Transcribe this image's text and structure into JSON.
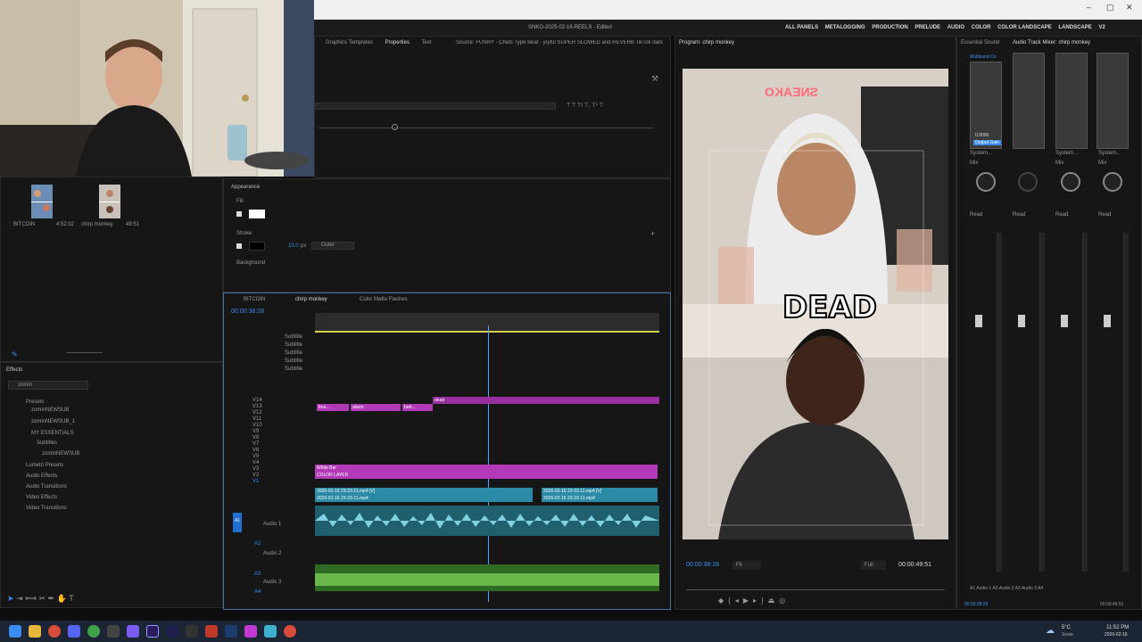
{
  "window": {
    "title": "SNKO-2025-02-16-REELS - Edited",
    "minimize": "–",
    "maximize": "▢",
    "close": "✕"
  },
  "workspaces": [
    "ALL PANELS",
    "METALOGGING",
    "PRODUCTION",
    "PRELUDE",
    "AUDIO",
    "COLOR",
    "COLOR LANDSCAPE",
    "LANDSCAPE",
    "V2"
  ],
  "source_panel": {
    "tabs": [
      "Graphics Templates",
      "Properties",
      "Text"
    ],
    "source_label": "Source: FUNNY - Chets Type Beat - joyful SUPER SLOWED and REVERB TikTok dancin"
  },
  "properties": {
    "appearance_label": "Appearance",
    "fill_label": "Fill",
    "stroke_label": "Stroke",
    "stroke_width": "10.0",
    "stroke_unit": "px",
    "stroke_type": "Outer",
    "background_label": "Background"
  },
  "project": {
    "items": [
      {
        "name": "BITCOIN",
        "duration": "4:52:02"
      },
      {
        "name": "chirp monkey",
        "duration": "49:51"
      }
    ]
  },
  "effects": {
    "title": "Effects",
    "search_value": "zomin",
    "tree": [
      "Presets",
      "zominNEWSUB",
      "zominNEWSUB_1",
      "MY ESSENTIALS",
      "Subtitles",
      "zominNEWSUB",
      "Lumetri Presets",
      "Audio Effects",
      "Audio Transitions",
      "Video Effects",
      "Video Transitions"
    ]
  },
  "timeline": {
    "tabs": [
      "BITCOIN",
      "chirp monkey",
      "Color Matte Flashes"
    ],
    "timecode": "00:00:38:28",
    "subtitle_tracks": [
      "Subtitle",
      "Subtitle",
      "Subtitle",
      "Subtitle",
      "Subtitle"
    ],
    "video_tracks": [
      "V14",
      "V13",
      "V12",
      "V11",
      "V10",
      "V9",
      "V8",
      "V7",
      "V6",
      "V5",
      "V4",
      "V3",
      "V2",
      "V1"
    ],
    "audio_tracks": [
      "A1",
      "A2",
      "A3",
      "A4"
    ],
    "audio_labels": [
      "Audio 1",
      "Audio 2",
      "Audio 3"
    ],
    "clips": {
      "white_bar": "White Bar",
      "color_layer": "COLOR LAYER",
      "video1": "2026-02-16 23-23-11.mp4 [V]",
      "video1b": "2026-02-16 23-23-11.mp4 [V]",
      "video2": "2026-02-16 23-23-11.mp4",
      "video2b": "2026-02-16 23-23-11.mp4",
      "caption_dead": "dead",
      "caption_a": "free...",
      "caption_b": "alarm",
      "caption_c": "bett..."
    }
  },
  "program": {
    "title": "Program: chirp monkey",
    "caption_top": "SNEAKO",
    "caption": "DEAD",
    "timecode": "00:00:38:28",
    "fit": "Fit",
    "quality": "Full",
    "duration": "00:00:49:51"
  },
  "mixer": {
    "tabs": [
      "Essential Sound",
      "Audio Track Mixer: chirp monkey"
    ],
    "channels": [
      "Multiband Co",
      "",
      "",
      ""
    ],
    "output_label": "Output Gain",
    "output_value": "0.0000",
    "system_label": "System...",
    "mix_label": "Mix",
    "read_label": "Read",
    "bottom_labels": [
      "A1",
      "Audio 1",
      "A2",
      "Audio 2",
      "A3",
      "Audio 3",
      "A4"
    ],
    "timecode_left": "00:00:38:28",
    "timecode_right": "00:00:49:51"
  },
  "taskbar": {
    "weather_temp": "5°C",
    "weather_desc": "Snow",
    "time": "11:52 PM",
    "date": "2026-02-16"
  },
  "colors": {
    "accent": "#3a8cf0",
    "clip_pink": "#b23ab8",
    "clip_teal": "#2b8aa6",
    "audio_teal": "#7fd0e0",
    "audio_green": "#6ab84a",
    "playhead": "#4aa8ff"
  }
}
